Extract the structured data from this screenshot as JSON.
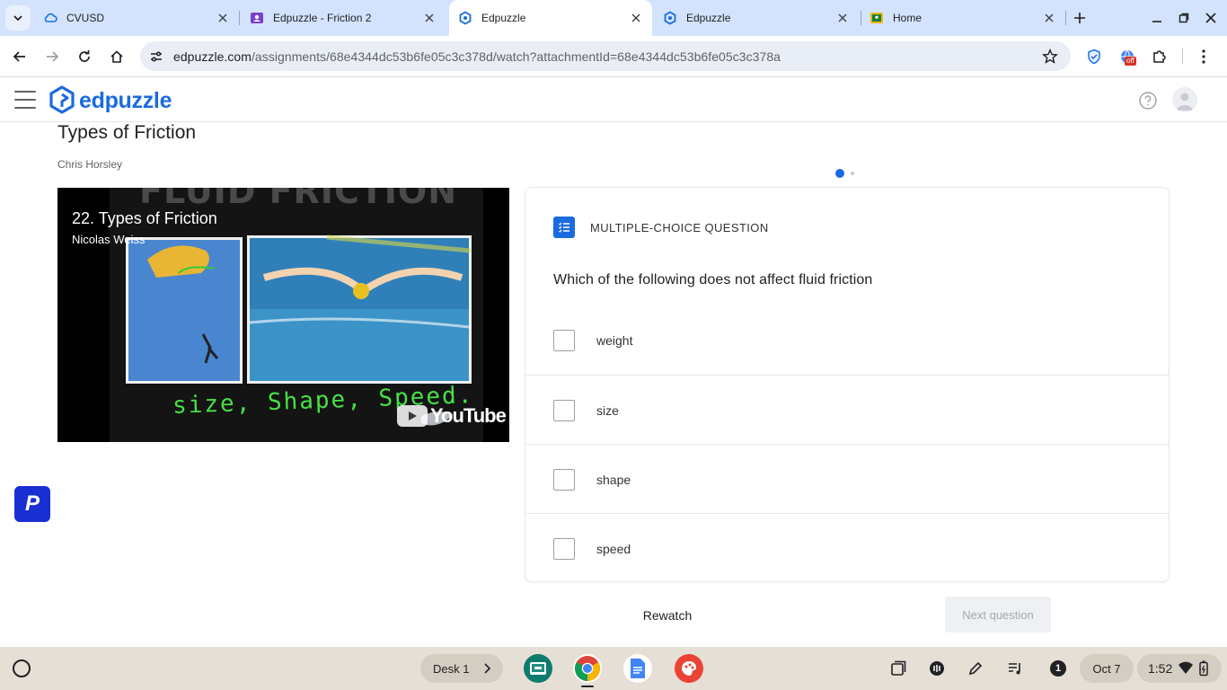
{
  "browser": {
    "tabs": [
      {
        "title": "CVUSD",
        "active": false
      },
      {
        "title": "Edpuzzle - Friction 2",
        "active": false
      },
      {
        "title": "Edpuzzle",
        "active": true
      },
      {
        "title": "Edpuzzle",
        "active": false
      },
      {
        "title": "Home",
        "active": false
      }
    ],
    "url_host": "edpuzzle.com",
    "url_path": "/assignments/68e4344dc53b6fe05c3c378d/watch?attachmentId=68e4344dc53b6fe05c3c378a",
    "ext_badge": "off"
  },
  "app": {
    "logo_text": "edpuzzle",
    "brand_color": "#1a6be0"
  },
  "assignment": {
    "title": "Types of Friction",
    "author": "Chris Horsley"
  },
  "video": {
    "title": "22. Types of Friction",
    "channel": "Nicolas Weiss",
    "banner_text": "FLUID FRICTION",
    "handwriting": "size, Shape, Speed.",
    "youtube_label": "YouTube"
  },
  "question": {
    "type_label": "MULTIPLE-CHOICE QUESTION",
    "text": "Which of the following does not affect fluid friction",
    "choices": [
      "weight",
      "size",
      "shape",
      "speed"
    ],
    "page_current": 1,
    "page_total": 2
  },
  "actions": {
    "rewatch_label": "Rewatch",
    "next_label": "Next question"
  },
  "extension_badge": "P",
  "shelf": {
    "desk_label": "Desk 1",
    "notification_count": "1",
    "date": "Oct 7",
    "time": "1:52"
  }
}
